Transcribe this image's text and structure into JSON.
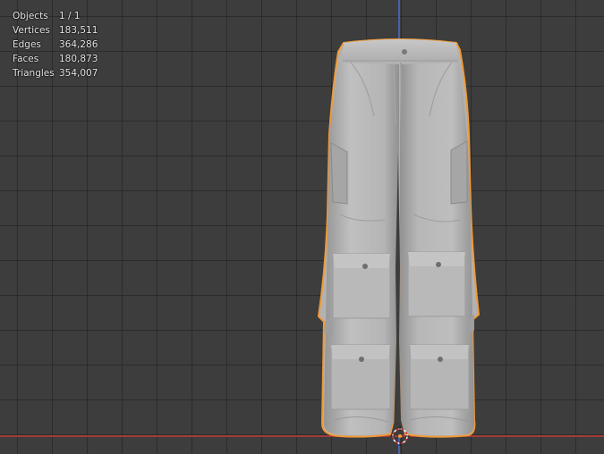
{
  "statistics": [
    {
      "label": "Objects",
      "value": "1 / 1"
    },
    {
      "label": "Vertices",
      "value": "183,511"
    },
    {
      "label": "Edges",
      "value": "364,286"
    },
    {
      "label": "Faces",
      "value": "180,873"
    },
    {
      "label": "Triangles",
      "value": "354,007"
    }
  ],
  "colors": {
    "viewport_bg": "#3d3d3d",
    "grid_line": "#2e2e2e",
    "axis_x": "#a33a3a",
    "axis_z": "#4a5fa8",
    "selection_outline": "#f09a38",
    "mesh_fill": "#b4b4b4"
  },
  "icons": {
    "origin": "3d-cursor-icon"
  }
}
